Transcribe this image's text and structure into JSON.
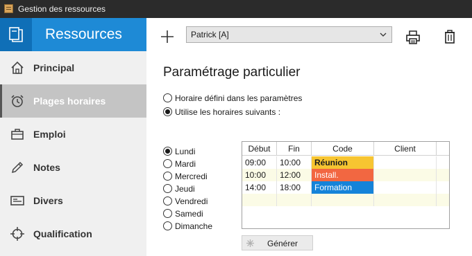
{
  "window": {
    "title": "Gestion des ressources"
  },
  "sidebar": {
    "header_title": "Ressources",
    "items": [
      {
        "label": "Principal",
        "icon": "home-icon",
        "active": false
      },
      {
        "label": "Plages horaires",
        "icon": "alarm-clock-icon",
        "active": true
      },
      {
        "label": "Emploi",
        "icon": "briefcase-icon",
        "active": false
      },
      {
        "label": "Notes",
        "icon": "pencil-icon",
        "active": false
      },
      {
        "label": "Divers",
        "icon": "id-card-icon",
        "active": false
      },
      {
        "label": "Qualification",
        "icon": "crosshair-icon",
        "active": false
      }
    ]
  },
  "toolbar": {
    "resource_selected": "Patrick  [A]"
  },
  "main": {
    "section_title": "Paramétrage particulier",
    "mode_options": [
      {
        "label": "Horaire défini dans les paramètres",
        "checked": false
      },
      {
        "label": "Utilise les horaires suivants :",
        "checked": true
      }
    ],
    "days": [
      {
        "label": "Lundi",
        "checked": true
      },
      {
        "label": "Mardi",
        "checked": false
      },
      {
        "label": "Mercredi",
        "checked": false
      },
      {
        "label": "Jeudi",
        "checked": false
      },
      {
        "label": "Vendredi",
        "checked": false
      },
      {
        "label": "Samedi",
        "checked": false
      },
      {
        "label": "Dimanche",
        "checked": false
      }
    ],
    "grid": {
      "columns": [
        "Début",
        "Fin",
        "Code",
        "Client"
      ],
      "rows": [
        {
          "debut": "09:00",
          "fin": "10:00",
          "code": "Réunion",
          "client": "",
          "code_color": "#f7c531",
          "code_bold": true,
          "code_text_color": "#1a1a1a"
        },
        {
          "debut": "10:00",
          "fin": "12:00",
          "code": "Install.",
          "client": "",
          "code_color": "#f26741",
          "code_bold": false,
          "code_text_color": "#ffffff"
        },
        {
          "debut": "14:00",
          "fin": "18:00",
          "code": "Formation",
          "client": "",
          "code_color": "#1583d9",
          "code_bold": false,
          "code_text_color": "#ffffff"
        }
      ]
    },
    "generate_label": "Générer"
  },
  "colors": {
    "sidebar_accent": "#1e8ad6",
    "active_item_bg": "#c4c4c4"
  }
}
